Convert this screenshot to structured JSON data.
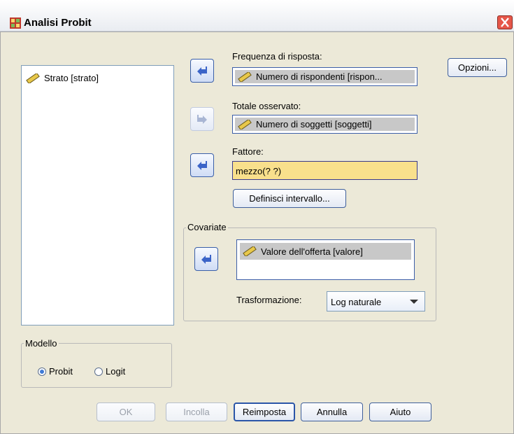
{
  "window": {
    "title": "Analisi Probit"
  },
  "variables": {
    "items": [
      {
        "label": "Strato [strato]",
        "icon": "ruler-icon"
      }
    ]
  },
  "response": {
    "label": "Frequenza di risposta:",
    "value": "Numero di rispondenti [rispon..."
  },
  "total": {
    "label": "Totale osservato:",
    "value": "Numero di soggetti [soggetti]"
  },
  "factor": {
    "label": "Fattore:",
    "value": "mezzo(? ?)"
  },
  "define_range": {
    "label": "Definisci intervallo..."
  },
  "options": {
    "label": "Opzioni..."
  },
  "covariates": {
    "title": "Covariate",
    "items": [
      {
        "label": "Valore dell'offerta [valore]",
        "icon": "ruler-icon"
      }
    ],
    "transform_label": "Trasformazione:",
    "transform_value": "Log naturale"
  },
  "model": {
    "title": "Modello",
    "options": [
      {
        "label": "Probit",
        "selected": true
      },
      {
        "label": "Logit",
        "selected": false
      }
    ]
  },
  "buttons": {
    "ok": "OK",
    "paste": "Incolla",
    "reset": "Reimposta",
    "cancel": "Annulla",
    "help": "Aiuto"
  },
  "colors": {
    "selection": "#c8c8c8",
    "factor_bg": "#f9e08c",
    "arrow": "#3b64c8",
    "close": "#e6574a"
  }
}
